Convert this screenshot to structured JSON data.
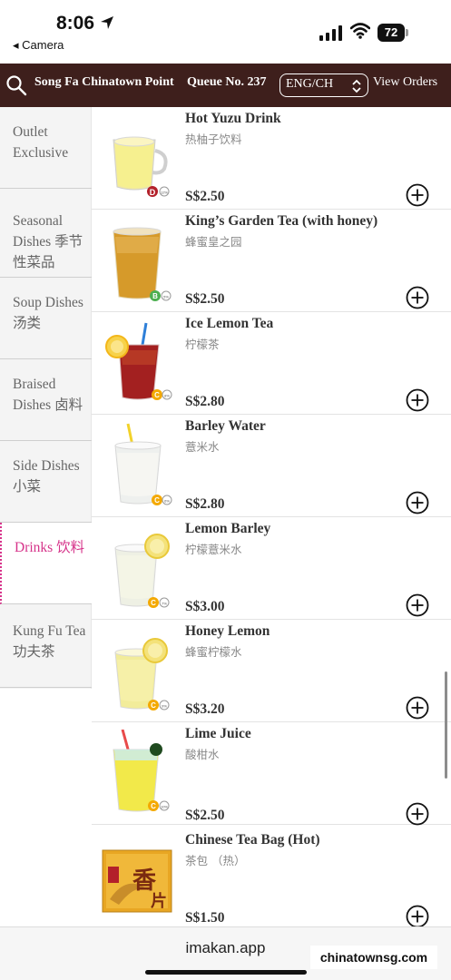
{
  "status": {
    "time": "8:06",
    "back_label": "Camera",
    "battery": "72"
  },
  "header": {
    "outlet": "Song Fa Chinatown Point",
    "queue": "Queue No. 237",
    "language": "ENG/CH",
    "view_orders": "View Orders"
  },
  "sidebar": {
    "items": [
      {
        "label": "Outlet Exclusive"
      },
      {
        "label": "Seasonal Dishes 季节性菜品"
      },
      {
        "label": "Soup Dishes 汤类"
      },
      {
        "label": "Braised Dishes 卤料"
      },
      {
        "label": "Side Dishes 小菜"
      },
      {
        "label": "Drinks 饮料"
      },
      {
        "label": "Kung Fu Tea 功夫茶"
      }
    ],
    "active_index": 5
  },
  "menu": {
    "items": [
      {
        "name": "Hot Yuzu Drink",
        "cn": "热柚子饮料",
        "price": "S$2.50",
        "grade": "D",
        "sugar": "12%",
        "grade_color": "#b3202a"
      },
      {
        "name": "King’s Garden Tea (with honey)",
        "cn": "蜂蜜皇之园",
        "price": "S$2.50",
        "grade": "B",
        "sugar": "5%",
        "grade_color": "#4caf50"
      },
      {
        "name": "Ice Lemon Tea",
        "cn": "柠檬茶",
        "price": "S$2.80",
        "grade": "C",
        "sugar": "8%",
        "grade_color": "#f4a900"
      },
      {
        "name": "Barley Water",
        "cn": "薏米水",
        "price": "S$2.80",
        "grade": "C",
        "sugar": "6%",
        "grade_color": "#f4a900"
      },
      {
        "name": "Lemon Barley",
        "cn": "柠檬薏米水",
        "price": "S$3.00",
        "grade": "C",
        "sugar": "7%",
        "grade_color": "#f4a900"
      },
      {
        "name": "Honey Lemon",
        "cn": "蜂蜜柠檬水",
        "price": "S$3.20",
        "grade": "C",
        "sugar": "9%",
        "grade_color": "#f4a900"
      },
      {
        "name": "Lime Juice",
        "cn": "酸柑水",
        "price": "S$2.50",
        "grade": "C",
        "sugar": "10%",
        "grade_color": "#f4a900"
      },
      {
        "name": "Chinese Tea Bag (Hot)",
        "cn": "茶包 （热）",
        "price": "S$1.50"
      }
    ]
  },
  "footer": {
    "url": "imakan.app",
    "watermark": "chinatownsg.com"
  },
  "colors": {
    "header_bg": "#3e1f1c",
    "active": "#d6338a"
  }
}
